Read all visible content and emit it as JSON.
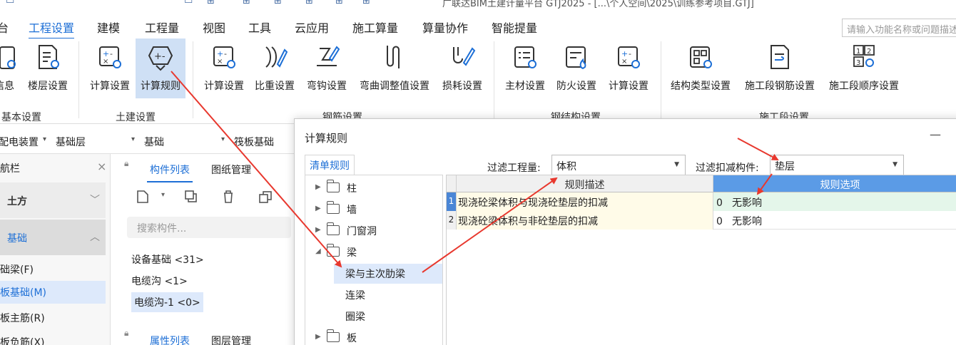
{
  "app": {
    "title": "广联达BIM土建计量平台 GTJ2025 - [...\\个人空间\\2025\\训练参考项目.GTJ]"
  },
  "menu": {
    "tabs": [
      {
        "label": "台",
        "active": false
      },
      {
        "label": "工程设置",
        "active": true
      },
      {
        "label": "建模",
        "active": false
      },
      {
        "label": "工程量",
        "active": false
      },
      {
        "label": "视图",
        "active": false
      },
      {
        "label": "工具",
        "active": false
      },
      {
        "label": "云应用",
        "active": false
      },
      {
        "label": "施工算量",
        "active": false
      },
      {
        "label": "算量协作",
        "active": false
      },
      {
        "label": "智能提量",
        "active": false
      }
    ],
    "search_placeholder": "请输入功能名称或问题描述"
  },
  "ribbon": {
    "buttons": [
      {
        "label": "信息",
        "icon": "info-icon"
      },
      {
        "label": "楼层设置",
        "icon": "floor-settings-icon"
      },
      {
        "label": "计算设置",
        "icon": "calc-settings-icon"
      },
      {
        "label": "计算规则",
        "icon": "calc-rule-icon",
        "active": true
      },
      {
        "label": "计算设置",
        "icon": "calc-settings-icon"
      },
      {
        "label": "比重设置",
        "icon": "weight-settings-icon"
      },
      {
        "label": "弯钩设置",
        "icon": "hook-settings-icon"
      },
      {
        "label": "弯曲调整值设置",
        "icon": "bend-adjust-icon"
      },
      {
        "label": "损耗设置",
        "icon": "loss-settings-icon"
      },
      {
        "label": "主材设置",
        "icon": "main-material-icon"
      },
      {
        "label": "防火设置",
        "icon": "fireproof-icon"
      },
      {
        "label": "计算设置",
        "icon": "calc-settings-icon"
      },
      {
        "label": "结构类型设置",
        "icon": "structure-type-icon"
      },
      {
        "label": "施工段钢筋设置",
        "icon": "segment-rebar-icon"
      },
      {
        "label": "施工段顺序设置",
        "icon": "segment-order-icon"
      }
    ],
    "groups": [
      "基本设置",
      "土建设置",
      "钢筋设置",
      "钢结构设置",
      "施工段设置"
    ]
  },
  "floorbar": {
    "items": [
      "配电装置",
      "基础层",
      "基础",
      "筏板基础"
    ]
  },
  "nav": {
    "title": "航栏",
    "categories": [
      "土方",
      "基础"
    ],
    "items": [
      "础梁(F)",
      "板基础(M)",
      "板主筋(R)",
      "板负筋(X)"
    ]
  },
  "components": {
    "tabs": [
      "构件列表",
      "图纸管理"
    ],
    "search_placeholder": "搜索构件...",
    "items": [
      "设备基础 <31>",
      "电缆沟 <1>",
      "电缆沟-1 <0>"
    ],
    "bottom_tabs": [
      "属性列表",
      "图层管理"
    ]
  },
  "dialog": {
    "title": "计算规则",
    "minimize": "—",
    "tab": "清单规则",
    "filter_qty_label": "过滤工程量:",
    "filter_qty_value": "体积",
    "filter_member_label": "过滤扣减构件:",
    "filter_member_value": "垫层",
    "tree": [
      {
        "label": "柱",
        "type": "folder"
      },
      {
        "label": "墙",
        "type": "folder"
      },
      {
        "label": "门窗洞",
        "type": "folder"
      },
      {
        "label": "梁",
        "type": "folder",
        "expanded": true
      },
      {
        "label": "梁与主次肋梁",
        "type": "leaf",
        "selected": true
      },
      {
        "label": "连梁",
        "type": "leaf"
      },
      {
        "label": "圈梁",
        "type": "leaf"
      },
      {
        "label": "板",
        "type": "folder"
      }
    ],
    "grid": {
      "headers": [
        "规则描述",
        "规则选项"
      ],
      "rows": [
        {
          "no": "1",
          "desc": "现浇砼梁体积与现浇砼垫层的扣减",
          "code": "0",
          "option": "无影响"
        },
        {
          "no": "2",
          "desc": "现浇砼梁体积与非砼垫层的扣减",
          "code": "0",
          "option": "无影响"
        }
      ]
    }
  },
  "colors": {
    "accent": "#1d6fd6",
    "annotation_arrow": "#e8382e",
    "header_selected": "#5b9be6"
  }
}
